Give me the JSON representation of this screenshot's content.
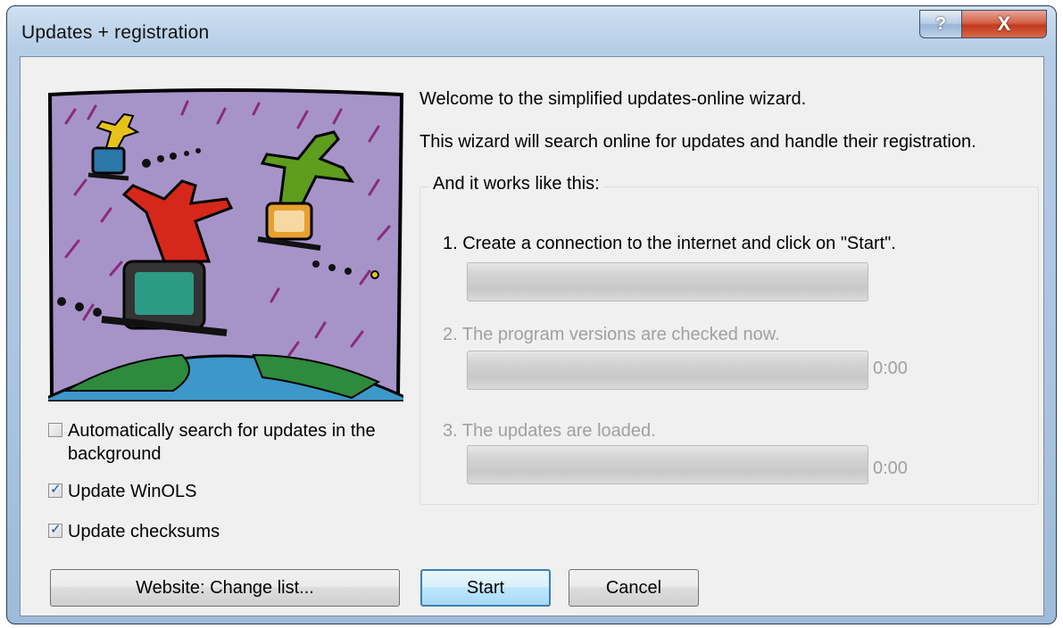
{
  "window": {
    "title": "Updates + registration",
    "help_glyph": "?",
    "close_glyph": "X"
  },
  "intro": {
    "welcome": "Welcome to the simplified updates-online wizard.",
    "description": "This wizard will search online for updates and handle their registration."
  },
  "options": [
    {
      "label": "Automatically search for updates in the background",
      "checked": false
    },
    {
      "label": "Update WinOLS",
      "checked": true
    },
    {
      "label": "Update checksums",
      "checked": true
    }
  ],
  "steps_group": {
    "title": "And it works like this:",
    "steps": [
      {
        "label": "1. Create a connection to the internet and click on \"Start\".",
        "enabled": true,
        "progress": 0
      },
      {
        "label": "2. The program versions are checked now.",
        "enabled": false,
        "progress": 0,
        "time": "0:00"
      },
      {
        "label": "3. The updates are loaded.",
        "enabled": false,
        "progress": 0,
        "time": "0:00"
      }
    ]
  },
  "buttons": {
    "website": "Website: Change list...",
    "start": "Start",
    "cancel": "Cancel"
  },
  "illustration": {
    "icon": "surfing-figures-on-computers-over-globe-illustration"
  },
  "colors": {
    "default_button_border": "#3c7fb1",
    "close_button": "#c23a1e",
    "disabled_text": "#a0a0a0"
  }
}
